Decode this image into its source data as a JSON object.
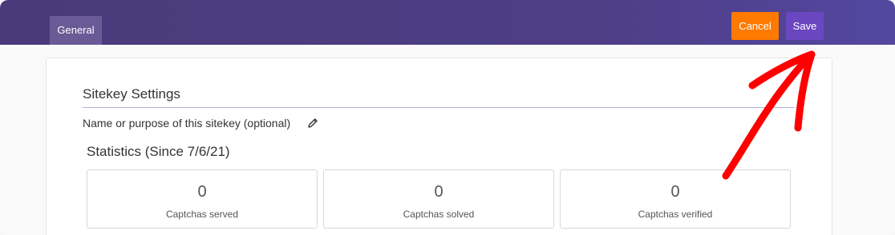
{
  "header": {
    "tab_general": "General",
    "cancel_label": "Cancel",
    "save_label": "Save"
  },
  "sitekey": {
    "section_title": "Sitekey Settings",
    "name_label": "Name or purpose of this sitekey (optional)"
  },
  "statistics": {
    "title": "Statistics (Since 7/6/21)",
    "items": [
      {
        "value": "0",
        "label": "Captchas served"
      },
      {
        "value": "0",
        "label": "Captchas solved"
      },
      {
        "value": "0",
        "label": "Captchas verified"
      }
    ]
  },
  "colors": {
    "header_bg": "#4b3d80",
    "cancel_bg": "#ff7a00",
    "save_bg": "#6b46c1",
    "annotation_arrow": "#ff0000"
  },
  "icons": {
    "edit": "pencil-icon",
    "annotation": "arrow-annotation-icon"
  }
}
